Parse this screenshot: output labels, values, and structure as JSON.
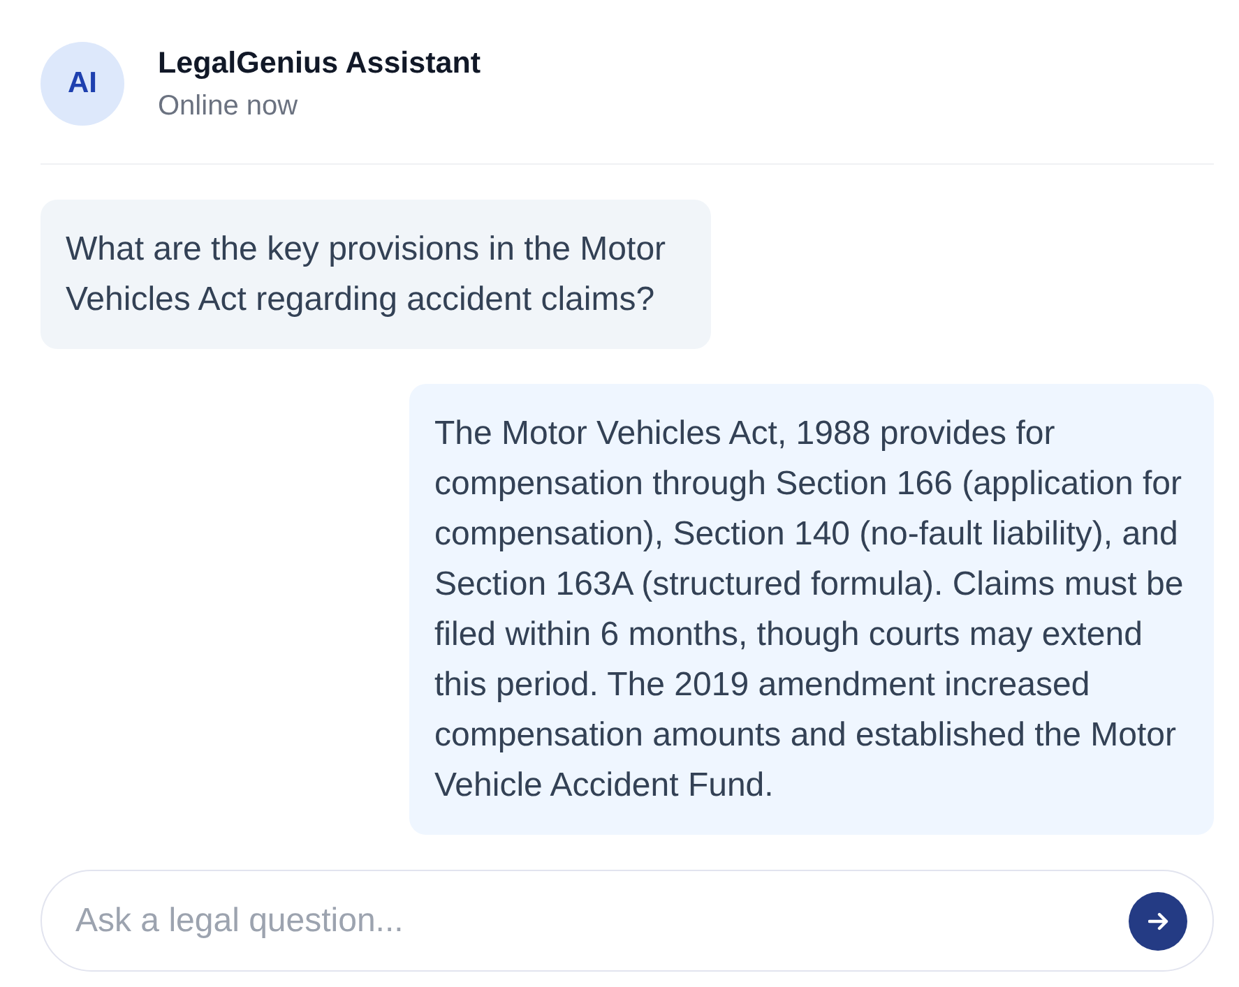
{
  "header": {
    "avatar": "AI",
    "name": "LegalGenius Assistant",
    "status": "Online now"
  },
  "messages": [
    {
      "kind": "question",
      "text": "What are the key provisions in the Motor Vehicles Act regarding accident claims?"
    },
    {
      "kind": "answer",
      "text": "The Motor Vehicles Act, 1988 provides for compensation through Section 166 (application for compensation), Section 140 (no-fault liability), and Section 163A (structured formula). Claims must be filed within 6 months, though courts may extend this period. The 2019 amendment increased compensation amounts and established the Motor Vehicle Accident Fund."
    }
  ],
  "composer": {
    "placeholder": "Ask a legal question..."
  }
}
